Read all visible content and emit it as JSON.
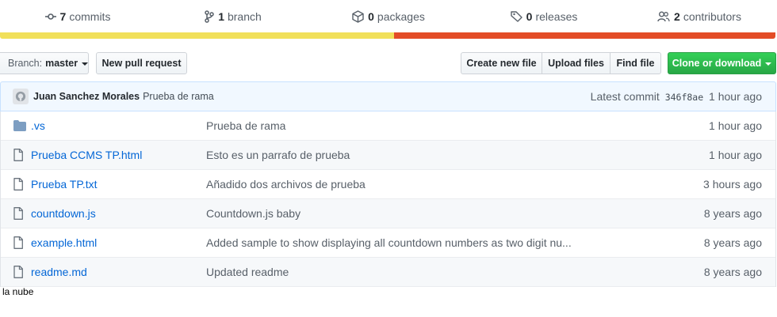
{
  "summary": {
    "commits": {
      "count": "7",
      "label": "commits",
      "icon": "commit-icon"
    },
    "branches": {
      "count": "1",
      "label": "branch",
      "icon": "branch-icon"
    },
    "packages": {
      "count": "0",
      "label": "packages",
      "icon": "package-icon"
    },
    "releases": {
      "count": "0",
      "label": "releases",
      "icon": "tag-icon"
    },
    "contributors": {
      "count": "2",
      "label": "contributors",
      "icon": "people-icon"
    }
  },
  "languages": [
    {
      "color": "#f1e05a",
      "share": 0.508
    },
    {
      "color": "#e34c26",
      "share": 0.492
    }
  ],
  "toolbar": {
    "branch_prefix": "Branch:",
    "branch_name": "master",
    "new_pull_request": "New pull request",
    "create_new_file": "Create new file",
    "upload_files": "Upload files",
    "find_file": "Find file",
    "clone_or_download": "Clone or download"
  },
  "latest_commit": {
    "author": "Juan Sanchez Morales",
    "message": "Prueba de rama",
    "label": "Latest commit",
    "sha": "346f8ae",
    "age": "1 hour ago"
  },
  "files": [
    {
      "type": "dir",
      "name": ".vs",
      "message": "Prueba de rama",
      "age": "1 hour ago"
    },
    {
      "type": "file",
      "name": "Prueba CCMS TP.html",
      "message": "Esto es un parrafo de prueba",
      "age": "1 hour ago"
    },
    {
      "type": "file",
      "name": "Prueba TP.txt",
      "message": "Añadido dos archivos de prueba",
      "age": "3 hours ago"
    },
    {
      "type": "file",
      "name": "countdown.js",
      "message": "Countdown.js baby",
      "age": "8 years ago"
    },
    {
      "type": "file",
      "name": "example.html",
      "message": "Added sample to show displaying all countdown numbers as two digit nu...",
      "age": "8 years ago"
    },
    {
      "type": "file",
      "name": "readme.md",
      "message": "Updated readme",
      "age": "8 years ago"
    }
  ],
  "footer_text": "la nube",
  "colors": {
    "accent_link": "#0366d6",
    "clone_button": "#28a745",
    "commit_bar_bg": "#f1f8ff"
  }
}
